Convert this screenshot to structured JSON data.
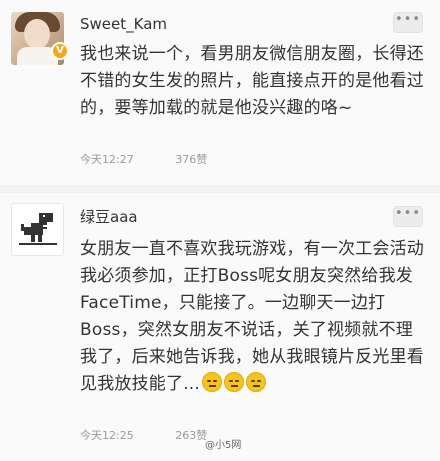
{
  "comments": [
    {
      "username": "Sweet_Kam",
      "verified_badge": "V",
      "more_label": "•••",
      "text": "我也来说一个，看男朋友微信朋友圈，长得还不错的女生发的照片，能直接点开的是他看过的，要等加载的就是他没兴趣的咯~",
      "time": "今天12:27",
      "likes": "376赞"
    },
    {
      "username": "绿豆aaa",
      "more_label": "•••",
      "text": "女朋友一直不喜欢我玩游戏，有一次工会活动我必须参加，正打Boss呢女朋友突然给我发FaceTime，只能接了。一边聊天一边打Boss，突然女朋友不说话，关了视频就不理我了，后来她告诉我，她从我眼镜片反光里看见我放技能了...",
      "time": "今天12:25",
      "likes": "263赞"
    }
  ],
  "watermark": "@小5网",
  "colors": {
    "background": "#f2f2f2",
    "card": "#fafafa",
    "verified_badge": "#f2a91b",
    "meta_text": "#9a9a9a"
  }
}
